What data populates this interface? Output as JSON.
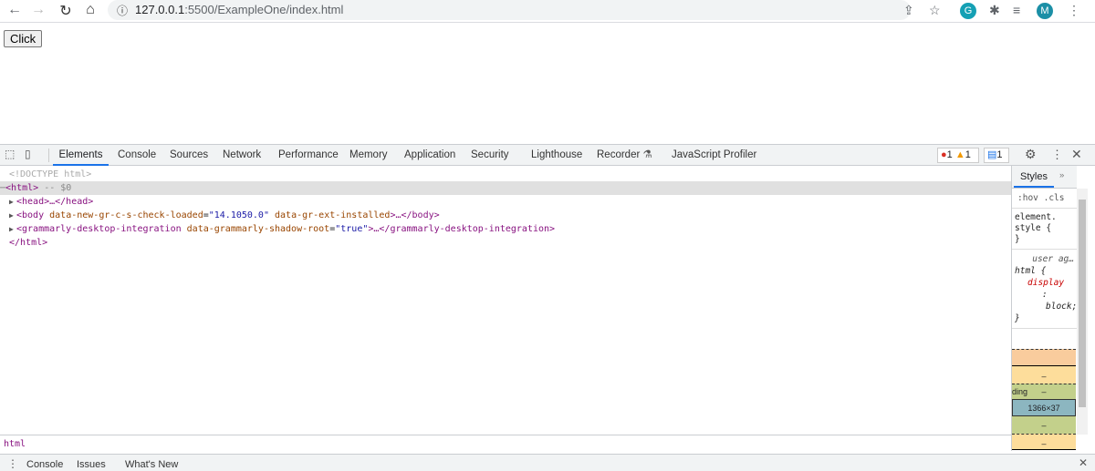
{
  "browser": {
    "url_host": "127.0.0.1",
    "url_path": ":5500/ExampleOne/index.html",
    "profile_initial": "M",
    "grammarly_initial": "G"
  },
  "page": {
    "button_label": "Click"
  },
  "devtools": {
    "tabs": [
      "Elements",
      "Console",
      "Sources",
      "Network",
      "Performance",
      "Memory",
      "Application",
      "Security",
      "Lighthouse",
      "Recorder",
      "JavaScript Profiler"
    ],
    "errors": "1",
    "warnings": "1",
    "messages": "1",
    "dom": {
      "doctype": "<!DOCTYPE html>",
      "html_open": "<html>",
      "selected_marker": "-- $0",
      "head": "<head>…</head>",
      "body_tag_open": "<body",
      "body_attr1": "data-new-gr-c-s-check-loaded",
      "body_val1": "\"14.1050.0\"",
      "body_attr2": "data-gr-ext-installed",
      "body_tail": ">…</body>",
      "gd_tag_open": "<grammarly-desktop-integration",
      "gd_attr": "data-grammarly-shadow-root",
      "gd_val": "\"true\"",
      "gd_tail": ">…</grammarly-desktop-integration>",
      "html_close": "</html>"
    },
    "styles": {
      "tab": "Styles",
      "more": "»",
      "filter": ":hov .cls",
      "rule1_selector": "element.",
      "rule1_open": "style {",
      "close": "}",
      "ua_label": "user ag…",
      "rule2_selector": "html {",
      "prop": "display",
      "colon": ":",
      "value": "block;",
      "box_dash": "–",
      "padding_label": "ding",
      "content_size": "1366×37"
    },
    "breadcrumb": "html",
    "drawer_tabs": [
      "Console",
      "Issues",
      "What's New"
    ]
  },
  "colors": {
    "accent": "#1a73e8",
    "margin": "#f9cc9d",
    "border": "#fddd9b",
    "padding": "#c3d08b",
    "content": "#8cb6c0"
  }
}
